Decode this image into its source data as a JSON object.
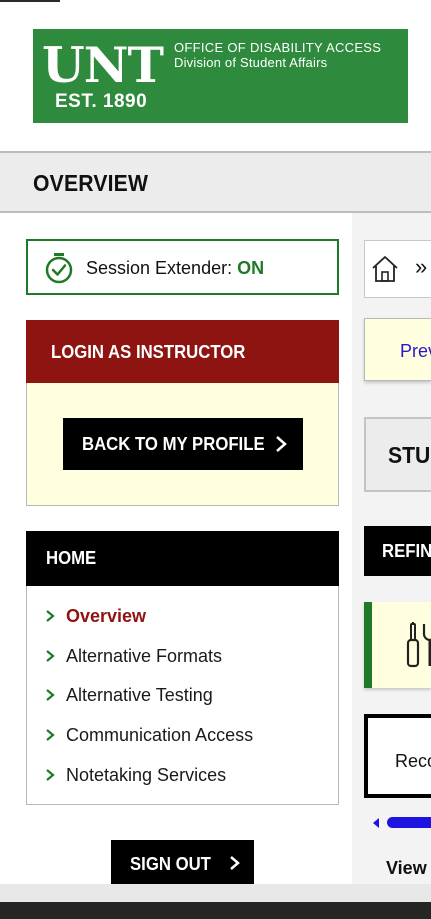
{
  "banner": {
    "logo_text": "UNT",
    "est_text": "EST. 1890",
    "office": "OFFICE OF DISABILITY ACCESS",
    "division": "Division of Student Affairs",
    "color": "#2e8b3d"
  },
  "page": {
    "title": "OVERVIEW"
  },
  "session": {
    "label": "Session Extender:",
    "state": "ON",
    "icon": "stopwatch-icon"
  },
  "instructor": {
    "title": "LOGIN AS INSTRUCTOR",
    "back_button": "BACK TO MY PROFILE",
    "header_color": "#8d1410"
  },
  "home": {
    "title": "HOME",
    "items": [
      {
        "label": "Overview",
        "active": true
      },
      {
        "label": "Alternative Formats",
        "active": false
      },
      {
        "label": "Alternative Testing",
        "active": false
      },
      {
        "label": "Communication Access",
        "active": false
      },
      {
        "label": "Notetaking Services",
        "active": false
      }
    ]
  },
  "signout": {
    "label": "SIGN OUT"
  },
  "content": {
    "breadcrumb_sep": "»",
    "prev_link": "Prev",
    "stud_heading": "STUD",
    "refine": "REFIN",
    "reco": "Reco",
    "view": "View"
  },
  "colors": {
    "accent_green": "#1f7a27",
    "cream": "#ffffdf",
    "link_blue": "#2a17c9",
    "scroll_blue": "#1d14e0"
  }
}
